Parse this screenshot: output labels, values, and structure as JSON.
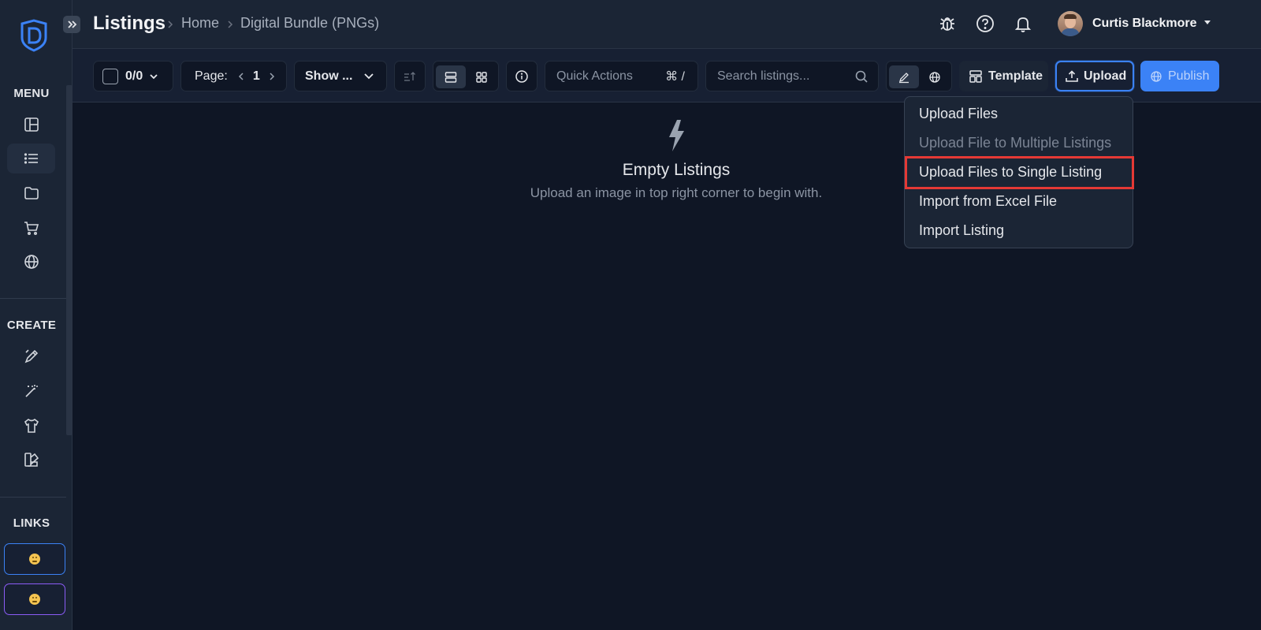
{
  "header": {
    "title": "Listings",
    "breadcrumbs": [
      "Home",
      "Digital Bundle (PNGs)"
    ],
    "user_name": "Curtis Blackmore"
  },
  "sidebar": {
    "menu_heading": "MENU",
    "create_heading": "CREATE",
    "links_heading": "LINKS",
    "menu_items": [
      "dashboard-icon",
      "list-icon",
      "folder-icon",
      "cart-icon",
      "globe-icon"
    ],
    "create_items": [
      "pen-icon",
      "magic-wand-icon",
      "tshirt-icon",
      "palette-icon"
    ]
  },
  "toolbar": {
    "selection_count": "0/0",
    "page_label": "Page:",
    "page_number": "1",
    "show_select": "Show ...",
    "quick_actions_placeholder": "Quick Actions",
    "quick_actions_shortcut": "⌘ /",
    "search_placeholder": "Search listings...",
    "template_label": "Template",
    "upload_label": "Upload",
    "publish_label": "Publish"
  },
  "upload_menu": {
    "items": [
      {
        "label": "Upload Files",
        "disabled": false
      },
      {
        "label": "Upload File to Multiple Listings",
        "disabled": true
      },
      {
        "label": "Upload Files to Single Listing",
        "disabled": false,
        "highlighted": true
      },
      {
        "label": "Import from Excel File",
        "disabled": false
      },
      {
        "label": "Import Listing",
        "disabled": false
      }
    ]
  },
  "empty_state": {
    "title": "Empty Listings",
    "subtitle": "Upload an image in top right corner to begin with."
  },
  "colors": {
    "accent": "#3b82f6",
    "highlight": "#e53935",
    "background": "#0f1625"
  }
}
